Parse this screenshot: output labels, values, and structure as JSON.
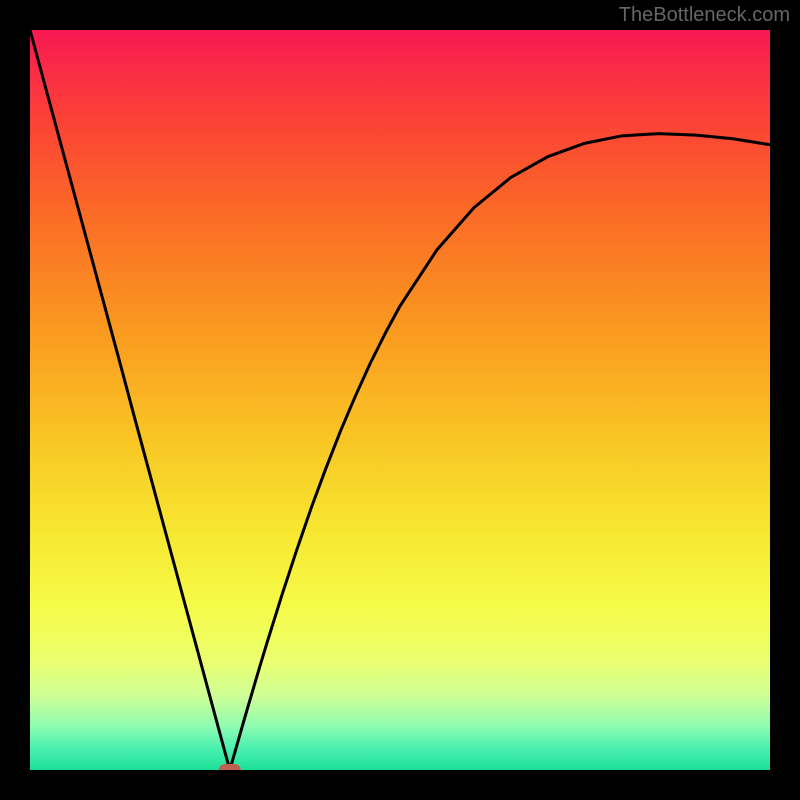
{
  "watermark": "TheBottleneck.com",
  "chart_data": {
    "type": "line",
    "title": "",
    "xlabel": "",
    "ylabel": "",
    "xlim": [
      0,
      100
    ],
    "ylim": [
      0,
      100
    ],
    "x": [
      0,
      2,
      4,
      6,
      8,
      10,
      12,
      14,
      16,
      18,
      20,
      22,
      24,
      26,
      27,
      28,
      29,
      30,
      31,
      32,
      34,
      36,
      38,
      40,
      42,
      44,
      46,
      48,
      50,
      55,
      60,
      65,
      70,
      75,
      80,
      85,
      90,
      95,
      100
    ],
    "values": [
      100,
      92.6,
      85.2,
      77.8,
      70.4,
      63.0,
      55.6,
      48.1,
      40.7,
      33.3,
      25.9,
      18.5,
      11.1,
      3.7,
      0,
      3.5,
      7.0,
      10.4,
      13.8,
      17.1,
      23.5,
      29.6,
      35.4,
      40.8,
      45.9,
      50.6,
      55.0,
      59.0,
      62.7,
      70.3,
      76.0,
      80.1,
      82.9,
      84.7,
      85.7,
      86.0,
      85.8,
      85.3,
      84.5
    ],
    "minimum_point": {
      "x": 27,
      "y": 0
    },
    "marker": {
      "color": "#c06050",
      "shape": "rounded-rect"
    },
    "background_gradient": {
      "stops": [
        {
          "offset": 0.0,
          "color": "#f71752"
        },
        {
          "offset": 0.05,
          "color": "#fa2b47"
        },
        {
          "offset": 0.12,
          "color": "#fb4136"
        },
        {
          "offset": 0.25,
          "color": "#fb6b26"
        },
        {
          "offset": 0.4,
          "color": "#fa9820"
        },
        {
          "offset": 0.55,
          "color": "#f9c524"
        },
        {
          "offset": 0.68,
          "color": "#f7e731"
        },
        {
          "offset": 0.78,
          "color": "#f5fb48"
        },
        {
          "offset": 0.85,
          "color": "#ecff6e"
        },
        {
          "offset": 0.9,
          "color": "#ceff95"
        },
        {
          "offset": 0.94,
          "color": "#90fcb1"
        },
        {
          "offset": 0.97,
          "color": "#4cf0b0"
        },
        {
          "offset": 1.0,
          "color": "#1de098"
        }
      ]
    },
    "line_color": "#000000",
    "line_width": 3
  }
}
